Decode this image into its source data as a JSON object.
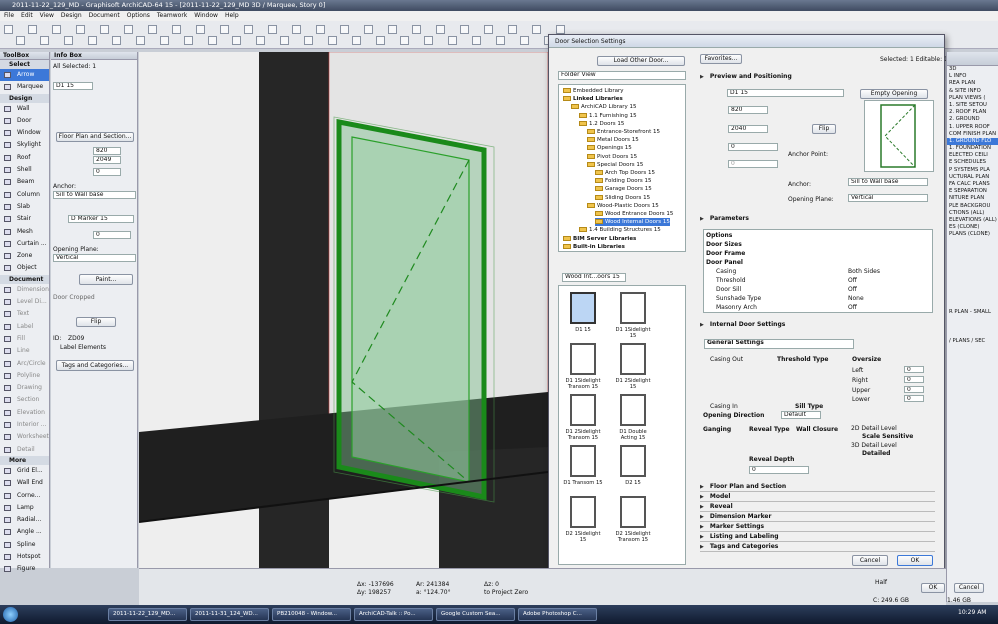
{
  "window": {
    "title": "2011-11-22_129_MD - Graphisoft ArchiCAD-64 15 - [2011-11-22_129_MD 3D / Marquee, Story 0]"
  },
  "menu": [
    "File",
    "Edit",
    "View",
    "Design",
    "Document",
    "Options",
    "Teamwork",
    "Window",
    "Help"
  ],
  "toolbox": {
    "title": "ToolBox",
    "select": "Select",
    "tools_top": [
      "Arrow",
      "Marquee"
    ],
    "design_label": "Design",
    "design": [
      "Wall",
      "Door",
      "Window",
      "Skylight",
      "Roof",
      "Shell",
      "Beam",
      "Column",
      "Slab",
      "Stair",
      "Mesh",
      "Curtain ...",
      "Zone",
      "Object"
    ],
    "document_label": "Document",
    "document": [
      "Dimension",
      "Level Di...",
      "Text",
      "Label",
      "Fill",
      "Line",
      "Arc/Circle",
      "Polyline",
      "Drawing",
      "Section",
      "Elevation",
      "Interior ...",
      "Worksheet",
      "Detail"
    ],
    "more_label": "More",
    "more": [
      "Grid El...",
      "Wall End",
      "Corne...",
      "Lamp",
      "Radial...",
      "Angle ...",
      "Spline",
      "Hotspot",
      "Figure"
    ]
  },
  "infobox": {
    "title": "Info Box",
    "selected": "All Selected: 1",
    "id_value": "D1 15",
    "plan_btn": "Floor Plan and Section...",
    "w": "820",
    "h": "2049",
    "val0": "0",
    "anchor_label": "Anchor:",
    "anchor": "Sill to Wall base",
    "marker": "D Marker 15",
    "marker_val": "0",
    "opening_label": "Opening Plane:",
    "opening": "Vertical",
    "paint": "Paint...",
    "cropped": "Door Cropped",
    "flip": "Flip",
    "id_label": "ID:",
    "id": "ZD09",
    "label_el": "Label Elements",
    "tags": "Tags and Categories..."
  },
  "dialog": {
    "title": "Door Selection Settings",
    "load": "Load Other Door...",
    "favorites": "Favorites...",
    "selected": "Selected: 1 Editable: 1",
    "folder_view": "Folder View",
    "tree": [
      "Embedded Library",
      "Linked Libraries",
      "ArchiCAD Library 15",
      "1.1 Furnishing 15",
      "1.2 Doors 15",
      "Entrance-Storefront 15",
      "Metal Doors 15",
      "Openings 15",
      "Pivot Doors 15",
      "Special Doors 15",
      "Arch Top Doors 15",
      "Folding Doors 15",
      "Garage Doors 15",
      "Sliding Doors 15",
      "Wood-Plastic Doors 15",
      "Wood Entrance Doors 15",
      "Wood Internal Doors 15",
      "1.4 Building Structures 15",
      "BIM Server Libraries",
      "Built-in Libraries"
    ],
    "folder_select": "Wood Int...oors 15",
    "thumbs": [
      "D1 15",
      "D1 1Sidelight 15",
      "D1 1Sidelight Transom 15",
      "D1 2Sidelight 15",
      "D1 2Sidelight Transom 15",
      "D1 Double Acting 15",
      "D1 Transom 15",
      "D2 15",
      "D2 1Sidelight 15",
      "D2 1Sidelight Transom 15"
    ],
    "preview_title": "Preview and Positioning",
    "name": "D1 15",
    "empty_opening": "Empty Opening",
    "width": "820",
    "height": "2040",
    "v0": "0",
    "v1": "0",
    "flip": "Flip",
    "anchor_point": "Anchor Point:",
    "anchor_label": "Anchor:",
    "anchor": "Sill to Wall base",
    "plane_label": "Opening Plane:",
    "plane": "Vertical",
    "params_title": "Parameters",
    "params": [
      [
        "Options",
        ""
      ],
      [
        "Door Sizes",
        ""
      ],
      [
        "Door Frame",
        ""
      ],
      [
        "Door Panel",
        ""
      ],
      [
        "Casing",
        "Both Sides"
      ],
      [
        "Threshold",
        "Off"
      ],
      [
        "Door Sill",
        "Off"
      ],
      [
        "Sunshade Type",
        "None"
      ],
      [
        "Masonry Arch",
        "Off"
      ]
    ],
    "internal_title": "Internal Door Settings",
    "general": "General Settings",
    "casing_out": "Casing Out",
    "threshold_type": "Threshold Type",
    "oversize": "Oversize",
    "left": "Left",
    "right": "Right",
    "upper": "Upper",
    "lower": "Lower",
    "casing_in": "Casing In",
    "sill_type": "Sill Type",
    "opening_dir": "Opening Direction",
    "default": "Default",
    "o_left": "0",
    "o_right": "0",
    "o_upper": "0",
    "o_lower": "0",
    "ganging": "Ganging",
    "reveal_type": "Reveal Type",
    "wall_closure": "Wall Closure",
    "reveal_depth": "Reveal Depth",
    "detail_2d": "2D Detail Level",
    "scale_sens": "Scale Sensitive",
    "detail_3d": "3D Detail Level",
    "detailed": "Detailed",
    "rd_val": "0",
    "sections": [
      "Floor Plan and Section",
      "Model",
      "Reveal",
      "Dimension Marker",
      "Marker Settings",
      "Listing and Labeling",
      "Tags and Categories"
    ],
    "cancel": "Cancel",
    "ok": "OK"
  },
  "status": {
    "dx": "Δx: -137696",
    "dy": "Δy: 198257",
    "ar": "Ar: 241384",
    "aa": "a: °124.70°",
    "dz": "Δz: 0",
    "rel": "to Project Zero",
    "disk": "C: 249.6 GB",
    "ram": "1.46 GB",
    "half": "Half",
    "ok": "OK",
    "cancel": "Cancel"
  },
  "rightpanel": [
    "3D",
    "L INFO",
    "REA PLAN",
    "& SITE INFO",
    "PLAN VIEWS (",
    "1. SITE SETOU",
    "2. ROOF PLAN",
    "2. GROUND",
    "1. UPPER ROOF",
    "COM FINISH PLAN",
    "1. GROUND FLO",
    "1. FOUNDATION",
    "ELECTED CEILI",
    "E SCHEDULES",
    "P SYSTEMS PLA",
    "UCTURAL PLAN",
    "FA CALC PLANS",
    "E SEPARATION",
    "NITURE PLAN",
    "PLE BACKGROU",
    "CTIONS (ALL)",
    "ELEVATIONS (ALL)",
    "ES (CLONE)",
    "PLANS (CLONE)"
  ],
  "rp_lower": [
    "R PLAN - SMALL",
    "/ PLANS / SEC"
  ],
  "taskbar": [
    "2011-11-22_129_MD...",
    "2011-11-31_124_WD...",
    "PB210048 - Window...",
    "ArchiCAD-Talk :: Po...",
    "Google Custom Sea...",
    "Adobe Photoshop C..."
  ],
  "clock": "10:29 AM"
}
